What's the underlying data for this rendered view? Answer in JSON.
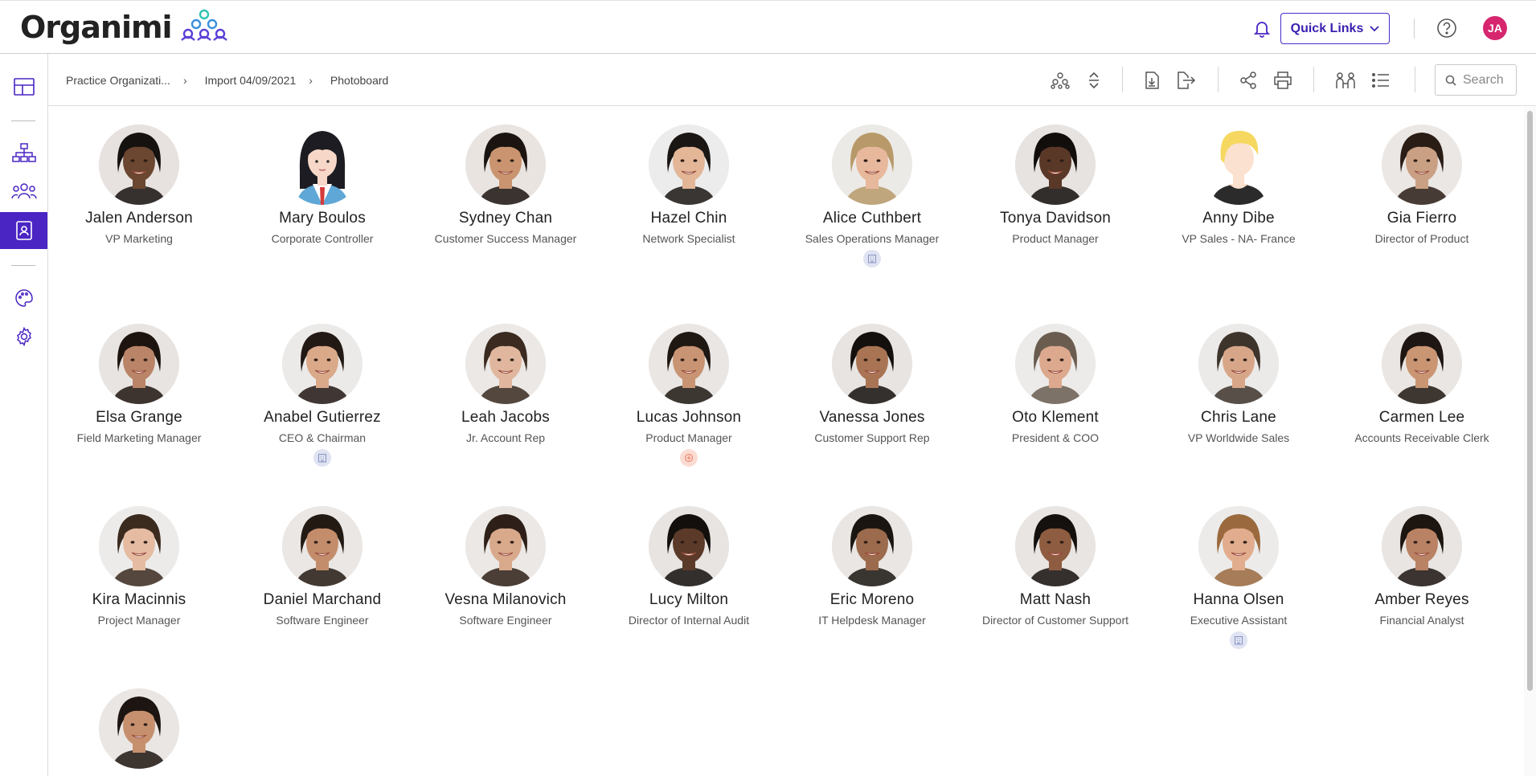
{
  "header": {
    "logo_text": "Organimi",
    "quick_links_label": "Quick Links",
    "avatar_initials": "JA"
  },
  "breadcrumb": {
    "items": [
      "Practice Organizati...",
      "Import 04/09/2021",
      "Photoboard"
    ]
  },
  "search": {
    "placeholder": "Search"
  },
  "colors": {
    "brand": "#4a25c4",
    "avatar": "#d6266e",
    "logo_mark": "#5b3fd6"
  },
  "people": [
    {
      "name": "Jalen Anderson",
      "title": "VP Marketing",
      "skin": "#6b4630",
      "hair": "#161210",
      "bg": "#e7e2df",
      "badge": ""
    },
    {
      "name": "Mary Boulos",
      "title": "Corporate Controller",
      "skin": "#f7d8c8",
      "hair": "#1c1c22",
      "bg": "#ffffff",
      "badge": "",
      "cartoon": "female-dark"
    },
    {
      "name": "Sydney Chan",
      "title": "Customer Success Manager",
      "skin": "#c9946f",
      "hair": "#1b1410",
      "bg": "#e9e4e0",
      "badge": ""
    },
    {
      "name": "Hazel Chin",
      "title": "Network Specialist",
      "skin": "#e2b697",
      "hair": "#1a1614",
      "bg": "#ececec",
      "badge": ""
    },
    {
      "name": "Alice Cuthbert",
      "title": "Sales Operations Manager",
      "skin": "#e8b89c",
      "hair": "#b89a6a",
      "bg": "#eceae6",
      "badge": "building"
    },
    {
      "name": "Tonya Davidson",
      "title": "Product Manager",
      "skin": "#5a3828",
      "hair": "#120e0c",
      "bg": "#e6e3e0",
      "badge": ""
    },
    {
      "name": "Anny Dibe",
      "title": "VP Sales - NA- France",
      "skin": "#fbe1cf",
      "hair": "#f6d860",
      "bg": "#ffffff",
      "badge": "",
      "cartoon": "blonde"
    },
    {
      "name": "Gia Fierro",
      "title": "Director of Product",
      "skin": "#caa084",
      "hair": "#2a1d16",
      "bg": "#ebe7e4",
      "badge": ""
    },
    {
      "name": "Elsa Grange",
      "title": "Field Marketing Manager",
      "skin": "#b98467",
      "hair": "#1e140f",
      "bg": "#e8e4e1",
      "badge": ""
    },
    {
      "name": "Anabel Gutierrez",
      "title": "CEO & Chairman",
      "skin": "#d9a98a",
      "hair": "#221814",
      "bg": "#eceae8",
      "badge": "building"
    },
    {
      "name": "Leah Jacobs",
      "title": "Jr. Account Rep",
      "skin": "#e0b79e",
      "hair": "#3a2a20",
      "bg": "#ebe8e5",
      "badge": ""
    },
    {
      "name": "Lucas Johnson",
      "title": "Product Manager",
      "skin": "#c89473",
      "hair": "#1f1712",
      "bg": "#e9e6e3",
      "badge": "pink"
    },
    {
      "name": "Vanessa Jones",
      "title": "Customer Support Rep",
      "skin": "#a97454",
      "hair": "#14100d",
      "bg": "#e8e4e1",
      "badge": ""
    },
    {
      "name": "Oto Klement",
      "title": "President & COO",
      "skin": "#dca98e",
      "hair": "#6a5d50",
      "bg": "#ecebe9",
      "badge": ""
    },
    {
      "name": "Chris Lane",
      "title": "VP Worldwide Sales",
      "skin": "#d7a689",
      "hair": "#3d342c",
      "bg": "#eceae8",
      "badge": ""
    },
    {
      "name": "Carmen Lee",
      "title": "Accounts Receivable Clerk",
      "skin": "#c99573",
      "hair": "#1e1612",
      "bg": "#eae6e3",
      "badge": ""
    },
    {
      "name": "Kira Macinnis",
      "title": "Project Manager",
      "skin": "#e5bca2",
      "hair": "#3b2a1e",
      "bg": "#ecebea",
      "badge": ""
    },
    {
      "name": "Daniel Marchand",
      "title": "Software Engineer",
      "skin": "#c38d6c",
      "hair": "#241a14",
      "bg": "#eae7e4",
      "badge": ""
    },
    {
      "name": "Vesna Milanovich",
      "title": "Software Engineer",
      "skin": "#d9a98c",
      "hair": "#2e2018",
      "bg": "#ebe8e5",
      "badge": ""
    },
    {
      "name": "Lucy Milton",
      "title": "Director of Internal Audit",
      "skin": "#5b3a2a",
      "hair": "#120f0d",
      "bg": "#e7e4e2",
      "badge": ""
    },
    {
      "name": "Eric Moreno",
      "title": "IT Helpdesk Manager",
      "skin": "#9c6a4c",
      "hair": "#1a1511",
      "bg": "#e9e6e3",
      "badge": ""
    },
    {
      "name": "Matt Nash",
      "title": "Director of Customer Support",
      "skin": "#8e5c40",
      "hair": "#15110e",
      "bg": "#e8e5e2",
      "badge": ""
    },
    {
      "name": "Hanna Olsen",
      "title": "Executive Assistant",
      "skin": "#e1ad8e",
      "hair": "#9a6a3e",
      "bg": "#ecebea",
      "badge": "building"
    },
    {
      "name": "Amber Reyes",
      "title": "Financial Analyst",
      "skin": "#b98264",
      "hair": "#1c1510",
      "bg": "#e9e5e2",
      "badge": ""
    },
    {
      "name": "",
      "title": "",
      "skin": "#c6906e",
      "hair": "#1d1511",
      "bg": "#eae6e3",
      "badge": ""
    }
  ]
}
